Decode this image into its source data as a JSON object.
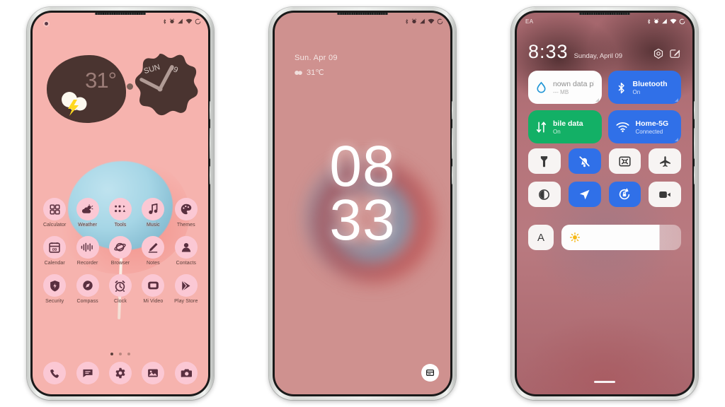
{
  "background_color": "#ffffff",
  "phones": {
    "home": {
      "label": "home-screen",
      "wallpaper_color": "#f6b3ae",
      "status_bar": {
        "left_text": "",
        "icons": [
          "bluetooth-icon",
          "alarm-icon",
          "signal-icon",
          "wifi-icon",
          "battery-icon"
        ]
      },
      "weather_widget": {
        "temperature": "31°",
        "icon": "cloud-lightning-icon"
      },
      "clock_widget": {
        "day": "SUN",
        "date": "09"
      },
      "apps_rows": [
        [
          {
            "label": "Calculator",
            "icon": "calculator-icon"
          },
          {
            "label": "Weather",
            "icon": "weather-icon"
          },
          {
            "label": "Tools",
            "icon": "tools-folder-icon"
          },
          {
            "label": "Music",
            "icon": "music-note-icon"
          },
          {
            "label": "Themes",
            "icon": "themes-palette-icon"
          }
        ],
        [
          {
            "label": "Calendar",
            "icon": "calendar-icon"
          },
          {
            "label": "Recorder",
            "icon": "recorder-waveform-icon"
          },
          {
            "label": "Browser",
            "icon": "browser-planet-icon"
          },
          {
            "label": "Notes",
            "icon": "notes-pencil-icon"
          },
          {
            "label": "Contacts",
            "icon": "contacts-person-icon"
          }
        ],
        [
          {
            "label": "Security",
            "icon": "security-shield-icon"
          },
          {
            "label": "Compass",
            "icon": "compass-icon"
          },
          {
            "label": "Clock",
            "icon": "alarm-clock-icon"
          },
          {
            "label": "Mi Video",
            "icon": "video-icon"
          },
          {
            "label": "Play Store",
            "icon": "play-store-icon"
          }
        ]
      ],
      "page_dots": {
        "count": 3,
        "active_index": 0
      },
      "dock": [
        {
          "label": "Phone",
          "icon": "phone-icon"
        },
        {
          "label": "Messages",
          "icon": "messages-icon"
        },
        {
          "label": "Settings",
          "icon": "gear-icon"
        },
        {
          "label": "Gallery",
          "icon": "gallery-image-icon"
        },
        {
          "label": "Camera",
          "icon": "camera-icon"
        }
      ]
    },
    "lock": {
      "label": "lock-screen",
      "status_bar": {
        "icons": [
          "bluetooth-icon",
          "alarm-icon",
          "signal-icon",
          "wifi-icon",
          "battery-icon"
        ]
      },
      "date": "Sun. Apr  09",
      "temperature": "31℃",
      "weather_icon": "cloud-icon",
      "clock_hours": "08",
      "clock_minutes": "33",
      "wallet_button_icon": "wallet-card-icon"
    },
    "quick_settings": {
      "label": "quick-settings-panel",
      "status_bar": {
        "carrier": "EA",
        "icons": [
          "bluetooth-icon",
          "alarm-icon",
          "signal-icon",
          "wifi-icon",
          "battery-icon"
        ]
      },
      "time": "8:33",
      "date": "Sunday, April 09",
      "header_icons": [
        "settings-hex-icon",
        "edit-icon"
      ],
      "big_tiles": [
        {
          "title": "nown data pla",
          "sub": "--- MB",
          "icon": "data-drop-icon",
          "state": "off",
          "color": "#fdfdfd"
        },
        {
          "title": "Bluetooth",
          "sub": "On",
          "icon": "bluetooth-icon",
          "state": "on",
          "color": "#3070e8"
        },
        {
          "title": "bile data",
          "sub": "On",
          "icon": "mobile-data-icon",
          "state": "on",
          "color": "#13b066"
        },
        {
          "title": "Home-5G",
          "sub": "Connected",
          "icon": "wifi-icon",
          "state": "on",
          "color": "#3070e8"
        }
      ],
      "toggles": [
        {
          "name": "flashlight-icon",
          "state": "off"
        },
        {
          "name": "silent-bell-off-icon",
          "state": "on"
        },
        {
          "name": "cast-screenshot-icon",
          "state": "off"
        },
        {
          "name": "airplane-mode-icon",
          "state": "off"
        },
        {
          "name": "dark-mode-icon",
          "state": "off"
        },
        {
          "name": "location-icon",
          "state": "on"
        },
        {
          "name": "auto-rotate-lock-icon",
          "state": "on"
        },
        {
          "name": "screen-record-icon",
          "state": "off"
        }
      ],
      "brightness": {
        "auto_label": "A",
        "icon": "sun-icon",
        "value_percent": 82
      }
    }
  }
}
